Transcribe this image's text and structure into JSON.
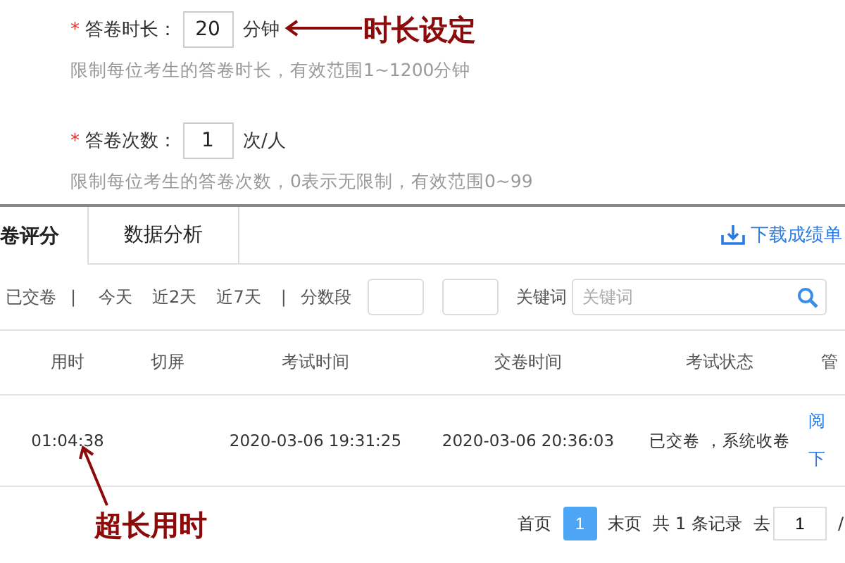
{
  "settings": [
    {
      "required_mark": "*",
      "label": "答卷时长：",
      "value": "20",
      "unit": "分钟",
      "hint": "限制每位考生的答卷时长，有效范围1~1200分钟"
    },
    {
      "required_mark": "*",
      "label": "答卷次数：",
      "value": "1",
      "unit": "次/人",
      "hint": "限制每位考生的答卷次数，0表示无限制，有效范围0~99"
    }
  ],
  "annotations": [
    {
      "text": "时长设定"
    },
    {
      "text": "超长用时"
    }
  ],
  "tabs": [
    {
      "label": "卷评分",
      "selected": true
    },
    {
      "label": "数据分析",
      "selected": false
    }
  ],
  "download_link": "下载成绩单",
  "filters": {
    "status": "已交卷",
    "separator_1": "|",
    "quick_ranges": [
      "今天",
      "近2天",
      "近7天"
    ],
    "separator_2": "|",
    "score_label": "分数段",
    "keyword_label": "关键词",
    "keyword_placeholder": "关键词"
  },
  "table": {
    "columns": [
      "用时",
      "切屏",
      "考试时间",
      "交卷时间",
      "考试状态",
      "管"
    ],
    "rows": [
      {
        "cells": [
          "01:04:38",
          "",
          "2020-03-06 19:31:25",
          "2020-03-06 20:36:03",
          "已交卷 ，系统收卷"
        ],
        "actions": [
          "阅",
          "下"
        ]
      }
    ]
  },
  "pagination": {
    "first": "首页",
    "pages": [
      {
        "label": "1",
        "selected": true
      }
    ],
    "last": "末页",
    "total": "共 1 条记录",
    "goto": "去",
    "goto_value": "1",
    "slash": "/"
  }
}
